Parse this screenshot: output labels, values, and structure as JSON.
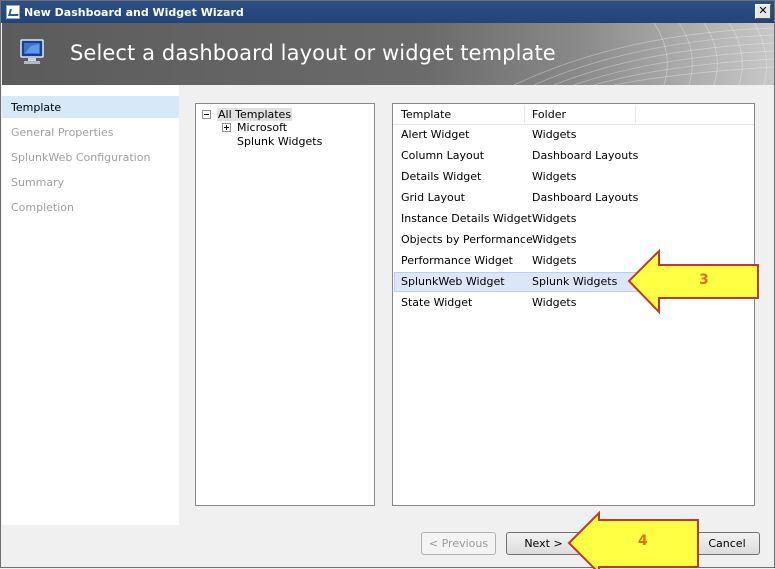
{
  "window": {
    "title": "New Dashboard and Widget Wizard",
    "close_label": "✕"
  },
  "header": {
    "title": "Select a dashboard layout or widget template"
  },
  "nav": {
    "items": [
      {
        "label": "Template",
        "active": true
      },
      {
        "label": "General Properties",
        "active": false
      },
      {
        "label": "SplunkWeb Configuration",
        "active": false
      },
      {
        "label": "Summary",
        "active": false
      },
      {
        "label": "Completion",
        "active": false
      }
    ]
  },
  "tree": {
    "root": {
      "label": "All Templates"
    },
    "children": [
      {
        "label": "Microsoft",
        "expandable": true
      },
      {
        "label": "Splunk Widgets",
        "expandable": false
      }
    ]
  },
  "list": {
    "columns": [
      "Template",
      "Folder"
    ],
    "rows": [
      {
        "template": "Alert Widget",
        "folder": "Widgets"
      },
      {
        "template": "Column Layout",
        "folder": "Dashboard Layouts"
      },
      {
        "template": "Details Widget",
        "folder": "Widgets"
      },
      {
        "template": "Grid Layout",
        "folder": "Dashboard Layouts"
      },
      {
        "template": "Instance Details Widget",
        "folder": "Widgets"
      },
      {
        "template": "Objects by Performance",
        "folder": "Widgets"
      },
      {
        "template": "Performance Widget",
        "folder": "Widgets"
      },
      {
        "template": "SplunkWeb Widget",
        "folder": "Splunk Widgets",
        "selected": true
      },
      {
        "template": "State Widget",
        "folder": "Widgets"
      }
    ]
  },
  "buttons": {
    "previous": "< Previous",
    "next": "Next >",
    "cancel": "Cancel"
  },
  "annotations": [
    {
      "number": "3"
    },
    {
      "number": "4"
    }
  ],
  "colors": {
    "arrow_fill": "#ffff44",
    "arrow_stroke": "#c0392b",
    "number": "#e07020",
    "selection": "#dbe6f6"
  }
}
